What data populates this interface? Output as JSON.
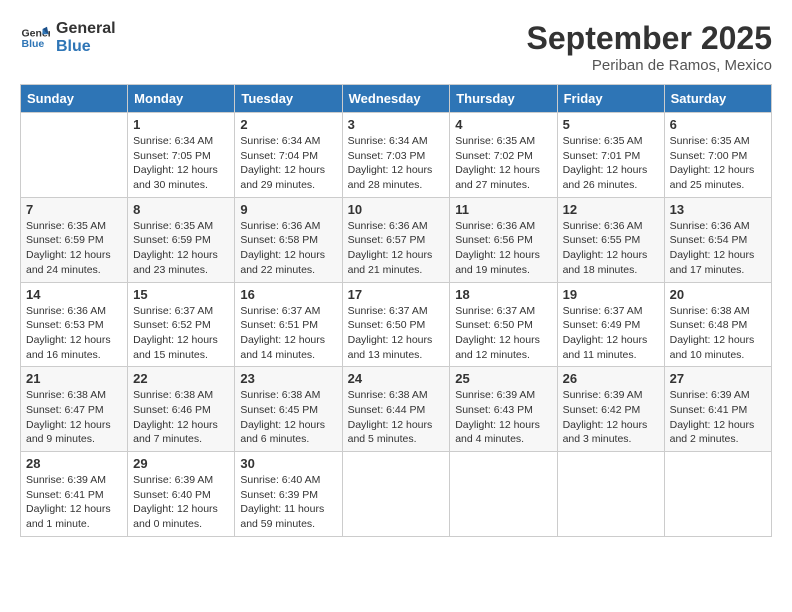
{
  "logo": {
    "line1": "General",
    "line2": "Blue"
  },
  "title": "September 2025",
  "location": "Periban de Ramos, Mexico",
  "days_header": [
    "Sunday",
    "Monday",
    "Tuesday",
    "Wednesday",
    "Thursday",
    "Friday",
    "Saturday"
  ],
  "weeks": [
    [
      {
        "day": "",
        "info": ""
      },
      {
        "day": "1",
        "info": "Sunrise: 6:34 AM\nSunset: 7:05 PM\nDaylight: 12 hours\nand 30 minutes."
      },
      {
        "day": "2",
        "info": "Sunrise: 6:34 AM\nSunset: 7:04 PM\nDaylight: 12 hours\nand 29 minutes."
      },
      {
        "day": "3",
        "info": "Sunrise: 6:34 AM\nSunset: 7:03 PM\nDaylight: 12 hours\nand 28 minutes."
      },
      {
        "day": "4",
        "info": "Sunrise: 6:35 AM\nSunset: 7:02 PM\nDaylight: 12 hours\nand 27 minutes."
      },
      {
        "day": "5",
        "info": "Sunrise: 6:35 AM\nSunset: 7:01 PM\nDaylight: 12 hours\nand 26 minutes."
      },
      {
        "day": "6",
        "info": "Sunrise: 6:35 AM\nSunset: 7:00 PM\nDaylight: 12 hours\nand 25 minutes."
      }
    ],
    [
      {
        "day": "7",
        "info": "Sunrise: 6:35 AM\nSunset: 6:59 PM\nDaylight: 12 hours\nand 24 minutes."
      },
      {
        "day": "8",
        "info": "Sunrise: 6:35 AM\nSunset: 6:59 PM\nDaylight: 12 hours\nand 23 minutes."
      },
      {
        "day": "9",
        "info": "Sunrise: 6:36 AM\nSunset: 6:58 PM\nDaylight: 12 hours\nand 22 minutes."
      },
      {
        "day": "10",
        "info": "Sunrise: 6:36 AM\nSunset: 6:57 PM\nDaylight: 12 hours\nand 21 minutes."
      },
      {
        "day": "11",
        "info": "Sunrise: 6:36 AM\nSunset: 6:56 PM\nDaylight: 12 hours\nand 19 minutes."
      },
      {
        "day": "12",
        "info": "Sunrise: 6:36 AM\nSunset: 6:55 PM\nDaylight: 12 hours\nand 18 minutes."
      },
      {
        "day": "13",
        "info": "Sunrise: 6:36 AM\nSunset: 6:54 PM\nDaylight: 12 hours\nand 17 minutes."
      }
    ],
    [
      {
        "day": "14",
        "info": "Sunrise: 6:36 AM\nSunset: 6:53 PM\nDaylight: 12 hours\nand 16 minutes."
      },
      {
        "day": "15",
        "info": "Sunrise: 6:37 AM\nSunset: 6:52 PM\nDaylight: 12 hours\nand 15 minutes."
      },
      {
        "day": "16",
        "info": "Sunrise: 6:37 AM\nSunset: 6:51 PM\nDaylight: 12 hours\nand 14 minutes."
      },
      {
        "day": "17",
        "info": "Sunrise: 6:37 AM\nSunset: 6:50 PM\nDaylight: 12 hours\nand 13 minutes."
      },
      {
        "day": "18",
        "info": "Sunrise: 6:37 AM\nSunset: 6:50 PM\nDaylight: 12 hours\nand 12 minutes."
      },
      {
        "day": "19",
        "info": "Sunrise: 6:37 AM\nSunset: 6:49 PM\nDaylight: 12 hours\nand 11 minutes."
      },
      {
        "day": "20",
        "info": "Sunrise: 6:38 AM\nSunset: 6:48 PM\nDaylight: 12 hours\nand 10 minutes."
      }
    ],
    [
      {
        "day": "21",
        "info": "Sunrise: 6:38 AM\nSunset: 6:47 PM\nDaylight: 12 hours\nand 9 minutes."
      },
      {
        "day": "22",
        "info": "Sunrise: 6:38 AM\nSunset: 6:46 PM\nDaylight: 12 hours\nand 7 minutes."
      },
      {
        "day": "23",
        "info": "Sunrise: 6:38 AM\nSunset: 6:45 PM\nDaylight: 12 hours\nand 6 minutes."
      },
      {
        "day": "24",
        "info": "Sunrise: 6:38 AM\nSunset: 6:44 PM\nDaylight: 12 hours\nand 5 minutes."
      },
      {
        "day": "25",
        "info": "Sunrise: 6:39 AM\nSunset: 6:43 PM\nDaylight: 12 hours\nand 4 minutes."
      },
      {
        "day": "26",
        "info": "Sunrise: 6:39 AM\nSunset: 6:42 PM\nDaylight: 12 hours\nand 3 minutes."
      },
      {
        "day": "27",
        "info": "Sunrise: 6:39 AM\nSunset: 6:41 PM\nDaylight: 12 hours\nand 2 minutes."
      }
    ],
    [
      {
        "day": "28",
        "info": "Sunrise: 6:39 AM\nSunset: 6:41 PM\nDaylight: 12 hours\nand 1 minute."
      },
      {
        "day": "29",
        "info": "Sunrise: 6:39 AM\nSunset: 6:40 PM\nDaylight: 12 hours\nand 0 minutes."
      },
      {
        "day": "30",
        "info": "Sunrise: 6:40 AM\nSunset: 6:39 PM\nDaylight: 11 hours\nand 59 minutes."
      },
      {
        "day": "",
        "info": ""
      },
      {
        "day": "",
        "info": ""
      },
      {
        "day": "",
        "info": ""
      },
      {
        "day": "",
        "info": ""
      }
    ]
  ]
}
